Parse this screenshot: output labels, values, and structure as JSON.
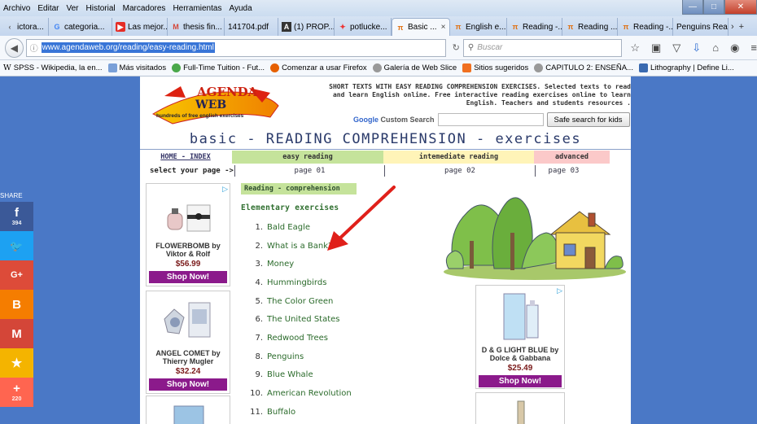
{
  "menu": [
    "Archivo",
    "Editar",
    "Ver",
    "Historial",
    "Marcadores",
    "Herramientas",
    "Ayuda"
  ],
  "tabs": [
    {
      "label": "ictora...",
      "icon": "shared-icon"
    },
    {
      "label": "categoria...",
      "icon": "google-icon"
    },
    {
      "label": "Las mejor...",
      "icon": "youtube-icon"
    },
    {
      "label": "thesis fin...",
      "icon": "gmail-icon"
    },
    {
      "label": "141704.pdf",
      "icon": "pdf-icon"
    },
    {
      "label": "(1) PROP...",
      "icon": "academia-icon"
    },
    {
      "label": "potlucke...",
      "icon": "potluck-icon"
    },
    {
      "label": "Basic ...",
      "icon": "agendaweb-icon",
      "active": true
    },
    {
      "label": "English e...",
      "icon": "agendaweb-icon"
    },
    {
      "label": "Reading -...",
      "icon": "agendaweb-icon"
    },
    {
      "label": "Reading ...",
      "icon": "agendaweb-icon"
    },
    {
      "label": "Reading -...",
      "icon": "agendaweb-icon"
    },
    {
      "label": "Penguins Rea...",
      "icon": "page-icon"
    }
  ],
  "navbar": {
    "url": "www.agendaweb.org/reading/easy-reading.html",
    "search_placeholder": "Buscar"
  },
  "bookmarks": [
    "SPSS - Wikipedia, la en...",
    "Más visitados",
    "Full-Time Tuition - Fut...",
    "Comenzar a usar Firefox",
    "Galería de Web Slice",
    "Sitios sugeridos",
    "CAPITULO 2: ENSEÑA...",
    "Lithography | Define Li..."
  ],
  "site": {
    "logo_top": "AGENDA",
    "logo_web": "WEB",
    "logo_sub": "hundreds of free english exercises",
    "header_text": "SHORT TEXTS WITH EASY READING COMPREHENSION EXERCISES. Selected texts to read and learn English online. Free interactive reading exercises online to learn English. Teachers and students resources .",
    "custom_search": "Custom Search",
    "google": "Google",
    "safe_search": "Safe search for kids",
    "title": "basic - READING COMPREHENSION - exercises"
  },
  "levels": {
    "home": "HOME - INDEX",
    "easy": "easy reading",
    "intermediate": "intemediate reading",
    "advanced": "advanced"
  },
  "pages": {
    "select": "select your page ->",
    "p1": "page 01",
    "p2": "page 02",
    "p3": "page 03"
  },
  "section": {
    "badge": "Reading - comprehension",
    "heading": "Elementary exercises"
  },
  "exercises": [
    "Bald Eagle",
    "What is a Bank?",
    "Money",
    "Hummingbirds",
    "The Color Green",
    "The United States",
    "Redwood Trees",
    "Penguins",
    "Blue Whale",
    "American Revolution",
    "Buffalo"
  ],
  "ads": [
    {
      "name": "FLOWERBOMB by Viktor & Rolf",
      "price": "$56.99",
      "button": "Shop Now!"
    },
    {
      "name": "ANGEL COMET by Thierry Mugler",
      "price": "$32.24",
      "button": "Shop Now!"
    },
    {
      "name": "D & G LIGHT BLUE by Dolce & Gabbana",
      "price": "$25.49",
      "button": "Shop Now!"
    }
  ],
  "share": {
    "label": "SHARE",
    "buttons": [
      {
        "icon": "facebook-icon",
        "glyph": "f",
        "count": "394",
        "color": "#3b5998"
      },
      {
        "icon": "twitter-icon",
        "glyph": "🐦",
        "count": "",
        "color": "#1da1f2"
      },
      {
        "icon": "googleplus-icon",
        "glyph": "G+",
        "count": "",
        "color": "#dd4b39"
      },
      {
        "icon": "blogger-icon",
        "glyph": "B",
        "count": "",
        "color": "#f57d00"
      },
      {
        "icon": "gmail-icon",
        "glyph": "M",
        "count": "",
        "color": "#d44638"
      },
      {
        "icon": "favorites-icon",
        "glyph": "★",
        "count": "",
        "color": "#f4b400"
      },
      {
        "icon": "more-icon",
        "glyph": "+",
        "count": "220",
        "color": "#ff6550"
      }
    ]
  },
  "colors": {
    "page_bg": "#4a78c6",
    "easy": "#c5e39b",
    "intermediate": "#fff4b8",
    "advanced": "#fbc9c9",
    "shop_button": "#8b1a8b",
    "annotation_arrow": "#e0201a"
  }
}
